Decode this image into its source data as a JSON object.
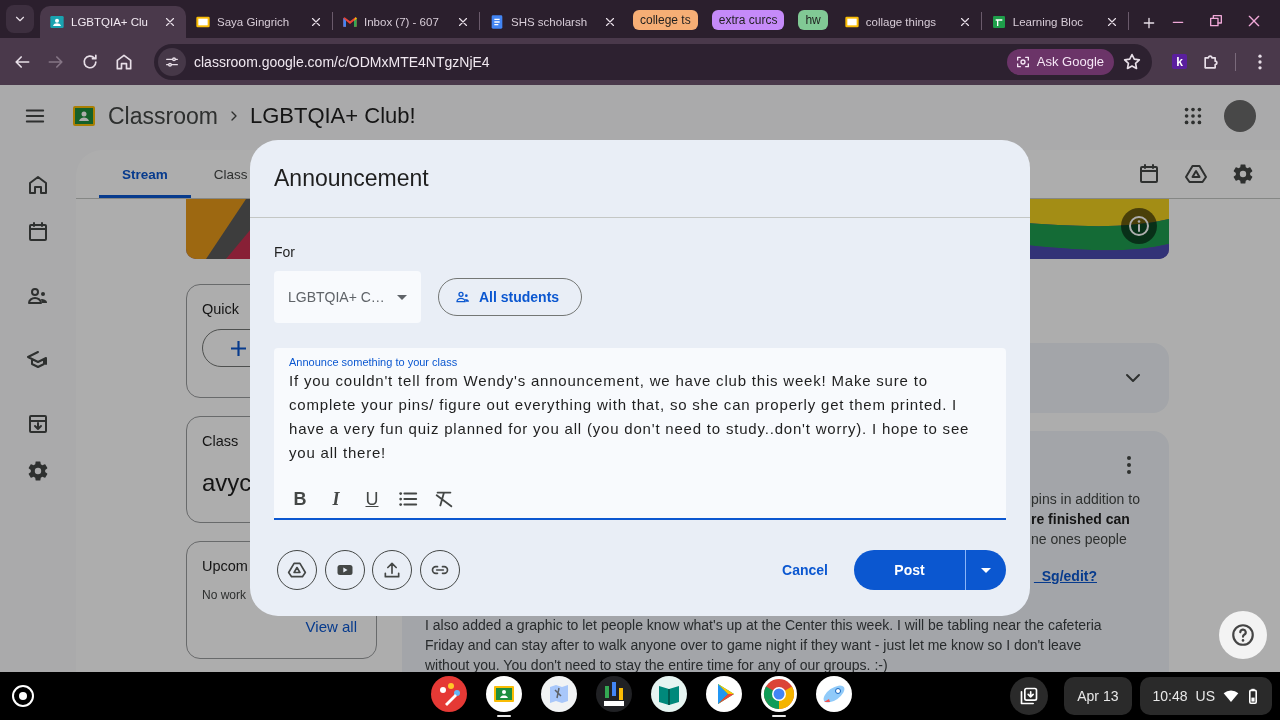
{
  "browser": {
    "tabs": [
      {
        "kind": "tab",
        "title": "LGBTQIA+ Clu",
        "selected": true
      },
      {
        "kind": "tab",
        "title": "Saya Gingrich",
        "selected": false
      },
      {
        "kind": "tab",
        "title": "Inbox (7) - 607",
        "selected": false
      },
      {
        "kind": "tab",
        "title": "SHS scholarsh",
        "selected": false
      },
      {
        "kind": "group",
        "title": "college ts",
        "color": "#f6ae75"
      },
      {
        "kind": "group",
        "title": "extra curcs",
        "color": "#c58af9"
      },
      {
        "kind": "group",
        "title": "hw",
        "color": "#81c995"
      },
      {
        "kind": "tab",
        "title": "collage things",
        "selected": false
      },
      {
        "kind": "tab",
        "title": "Learning Bloc",
        "selected": false
      }
    ],
    "forward_disabled": true,
    "url": "classroom.google.com/c/ODMxMTE4NTgzNjE4",
    "ask_button": "Ask Google",
    "extension_label": "k"
  },
  "header": {
    "app": "Classroom",
    "class_name": "LGBTQIA+ Club!"
  },
  "class_tabs": [
    {
      "label": "Stream",
      "selected": true
    },
    {
      "label": "Class",
      "selected": false
    }
  ],
  "side_cards": {
    "quick_title": "Quick",
    "class_code_title": "Class",
    "class_code": "avyc",
    "upcoming_title": "Upcom",
    "upcoming_text": "No work",
    "view_all": "View all"
  },
  "post": {
    "fragments": [
      {
        "text": "pins in addition to",
        "bold": false
      },
      {
        "text": "re finished can",
        "bold": true
      },
      {
        "text": "ne ones people",
        "bold": false
      }
    ],
    "link": "_Sg/edit?",
    "paragraph": "I also added a graphic to let people know what's up at the Center this week. I will be tabling near the cafeteria Friday and can stay after to walk anyone over to game night if they want - just let me know so I don't leave without you. You don't need to stay the entire time for any of our groups. :-)"
  },
  "dialog": {
    "title": "Announcement",
    "for_label": "For",
    "class_select": "LGBTQIA+ C…",
    "audience_button": "All students",
    "field_label": "Announce something to your class",
    "body": "If you couldn't tell from Wendy's announcement, we have club this week! Make sure to complete your pins/ figure out everything with that, so she can properly get them printed. I have a very fun quiz planned for you all (you don't need to study..don't worry). I hope to see you all there!",
    "format_buttons": [
      {
        "kind": "bold",
        "label": "B"
      },
      {
        "kind": "italic",
        "label": "I"
      },
      {
        "kind": "underline",
        "label": "U"
      },
      {
        "kind": "list"
      },
      {
        "kind": "clear"
      }
    ],
    "cancel": "Cancel",
    "post": "Post"
  },
  "taskbar": {
    "apps": [
      {
        "running": false
      },
      {
        "running": true
      },
      {
        "running": false
      },
      {
        "running": false
      },
      {
        "running": false
      },
      {
        "running": false
      },
      {
        "running": true
      },
      {
        "running": false
      }
    ],
    "date": "Apr 13",
    "time": "10:48",
    "locale": "US"
  }
}
